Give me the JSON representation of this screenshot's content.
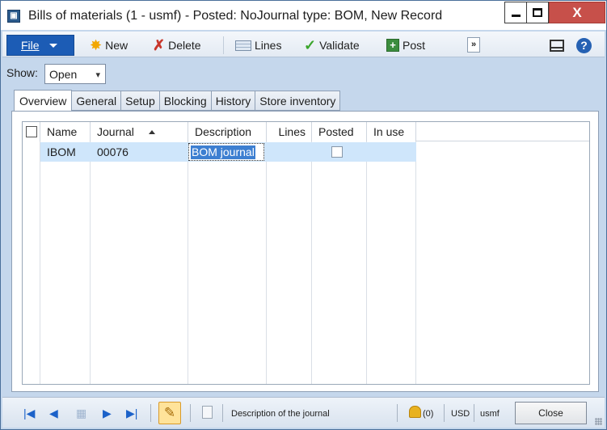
{
  "window": {
    "title": "Bills of materials (1 - usmf) - Posted: NoJournal type: BOM, New Record",
    "close_glyph": "X"
  },
  "action_pane": {
    "file": "File",
    "new": "New",
    "delete": "Delete",
    "lines": "Lines",
    "validate": "Validate",
    "post": "Post",
    "more": "»",
    "help": "?"
  },
  "filter": {
    "label": "Show:",
    "value": "Open"
  },
  "tabs": [
    "Overview",
    "General",
    "Setup",
    "Blocking",
    "History",
    "Store inventory"
  ],
  "grid": {
    "columns": {
      "name": "Name",
      "journal": "Journal",
      "description": "Description",
      "lines": "Lines",
      "posted": "Posted",
      "in_use": "In use"
    },
    "rows": [
      {
        "name": "IBOM",
        "journal": "00076",
        "description": "BOM journal",
        "lines": "",
        "posted": false,
        "in_use": ""
      }
    ]
  },
  "status_bar": {
    "field_help": "Description of the journal",
    "alerts": "(0)",
    "currency": "USD",
    "company": "usmf",
    "close": "Close"
  },
  "colors": {
    "accent": "#1c5cb5",
    "selected_row": "#cfe6fb",
    "selection": "#3d7fd1"
  }
}
